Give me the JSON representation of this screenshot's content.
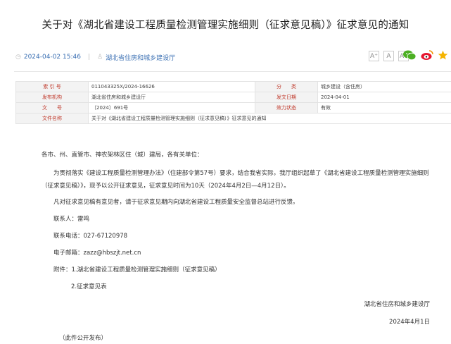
{
  "article": {
    "title": "关于对《湖北省建设工程质量检测管理实施细则（征求意见稿）》征求意见的通知",
    "datetime": "2024-04-02 15:46",
    "separator": "|",
    "source": "湖北省住房和城乡建设厅",
    "font_sizes": [
      "A⁺",
      "A",
      "A⁻"
    ]
  },
  "info_table": {
    "rows": [
      [
        "索 引 号",
        "011043325X/2024-16626",
        "分　　类",
        "城乡建设（含住房）"
      ],
      [
        "发布机构",
        "湖北省住房和城乡建设厅",
        "发文日期",
        "2024-04-01"
      ],
      [
        "文　　号",
        "〔2024〕691号",
        "效力状态",
        "有效"
      ]
    ],
    "name_label": "文件名称",
    "name_value": "关于对《湖北省建设工程质量检测管理实施细则（征求意见稿）》征求意见的通知"
  },
  "content": {
    "greeting": "各市、州、直管市、神农架林区住（城）建局，各有关单位：",
    "para1": "为贯彻落实《建设工程质量检测管理办法》（住建部令第57号）要求，结合我省实际，我厅组织起草了《湖北省建设工程质量检测管理实施细则（征求意见稿）》，现予以公开征求意见，征求意见时间为10天（2024年4月2日—4月12日）。",
    "para2": "凡对征求意见稿有意见者，请于征求意见期内向湖北省建设工程质量安全监督总站进行反馈。",
    "contact": "联系人：雷鸣",
    "phone": "联系电话：027-67120978",
    "email": "电子邮箱：zazz@hbszjt.net.cn",
    "attach1": "附件：1.湖北省建设工程质量检测管理实施细则（征求意见稿）",
    "attach2": "2.征求意见表",
    "signature": "湖北省住房和城乡建设厅",
    "date": "2024年4月1日",
    "note": "（此件公开发布）"
  },
  "icons": {
    "clock": "clock-icon",
    "person": "person-icon",
    "wechat": "wechat-icon",
    "weibo": "weibo-icon",
    "favorite": "star-icon"
  },
  "colors": {
    "link": "#3a6fb3",
    "table_key": "#c0392b",
    "wechat": "#4caf23",
    "weibo": "#e6162d",
    "star": "#f5b400"
  }
}
